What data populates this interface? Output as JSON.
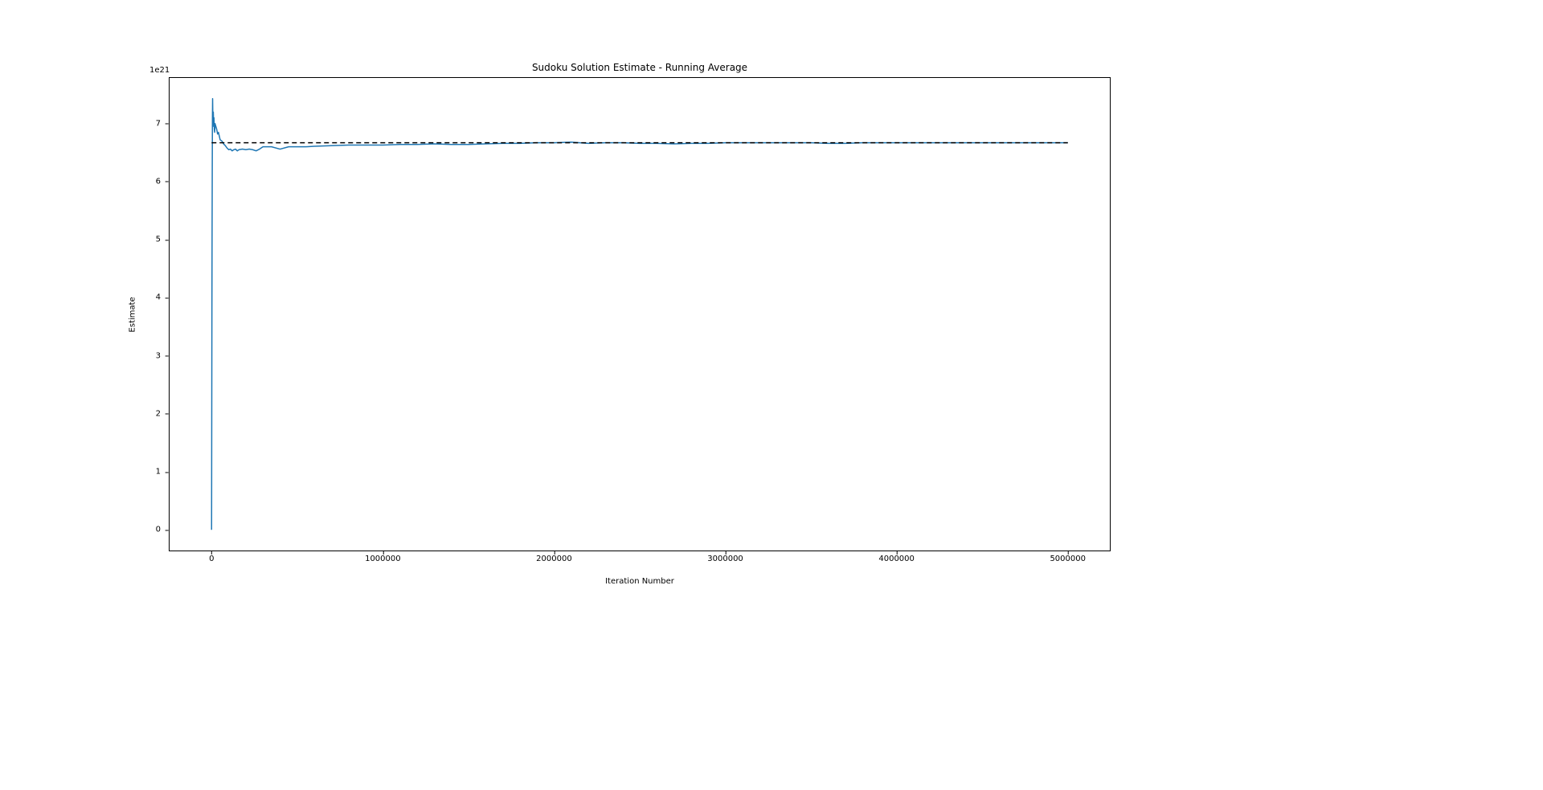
{
  "chart_data": {
    "type": "line",
    "title": "Sudoku Solution Estimate - Running Average",
    "xlabel": "Iteration Number",
    "ylabel": "Estimate",
    "y_offset_text": "1e21",
    "xlim": [
      -250000,
      5250000
    ],
    "ylim": [
      -0.37,
      7.8
    ],
    "y_scale_factor": 1e+21,
    "xticks": [
      0,
      1000000,
      2000000,
      3000000,
      4000000,
      5000000
    ],
    "xtick_labels": [
      "0",
      "1000000",
      "2000000",
      "3000000",
      "4000000",
      "5000000"
    ],
    "yticks": [
      0,
      1,
      2,
      3,
      4,
      5,
      6,
      7
    ],
    "ytick_labels": [
      "0",
      "1",
      "2",
      "3",
      "4",
      "5",
      "6",
      "7"
    ],
    "reference_line": {
      "y": 6.67,
      "xmin": 0,
      "xmax": 5000000,
      "style": "dashed",
      "color": "#000000"
    },
    "series": [
      {
        "name": "Running Average",
        "color": "#1f77b4",
        "linewidth": 1.5,
        "x": [
          0,
          2000,
          3000,
          4000,
          5000,
          6000,
          8000,
          10000,
          12000,
          14000,
          16000,
          18000,
          20000,
          25000,
          30000,
          35000,
          40000,
          50000,
          60000,
          70000,
          80000,
          90000,
          100000,
          110000,
          120000,
          130000,
          140000,
          150000,
          160000,
          180000,
          200000,
          220000,
          240000,
          260000,
          280000,
          300000,
          350000,
          400000,
          450000,
          500000,
          550000,
          600000,
          700000,
          800000,
          900000,
          1000000,
          1100000,
          1200000,
          1300000,
          1400000,
          1500000,
          1600000,
          1700000,
          1800000,
          1900000,
          2000000,
          2100000,
          2200000,
          2300000,
          2400000,
          2500000,
          2600000,
          2700000,
          2800000,
          2900000,
          3000000,
          3100000,
          3200000,
          3300000,
          3400000,
          3500000,
          3600000,
          3700000,
          3800000,
          3900000,
          4000000,
          4100000,
          4200000,
          4300000,
          4400000,
          4500000,
          4600000,
          4700000,
          4800000,
          4900000,
          5000000
        ],
        "y": [
          0.0,
          3.9,
          5.2,
          6.3,
          7.1,
          7.43,
          6.95,
          7.2,
          7.0,
          7.1,
          6.9,
          6.85,
          7.0,
          6.95,
          6.9,
          6.82,
          6.85,
          6.72,
          6.7,
          6.65,
          6.62,
          6.58,
          6.55,
          6.56,
          6.53,
          6.55,
          6.56,
          6.53,
          6.55,
          6.56,
          6.55,
          6.56,
          6.55,
          6.53,
          6.56,
          6.6,
          6.6,
          6.56,
          6.6,
          6.6,
          6.6,
          6.61,
          6.62,
          6.63,
          6.63,
          6.63,
          6.64,
          6.64,
          6.65,
          6.64,
          6.64,
          6.65,
          6.66,
          6.66,
          6.67,
          6.67,
          6.68,
          6.66,
          6.67,
          6.67,
          6.66,
          6.66,
          6.65,
          6.66,
          6.66,
          6.67,
          6.67,
          6.67,
          6.67,
          6.67,
          6.67,
          6.66,
          6.66,
          6.67,
          6.67,
          6.67,
          6.67,
          6.67,
          6.67,
          6.67,
          6.67,
          6.67,
          6.67,
          6.67,
          6.67,
          6.67
        ]
      }
    ]
  }
}
